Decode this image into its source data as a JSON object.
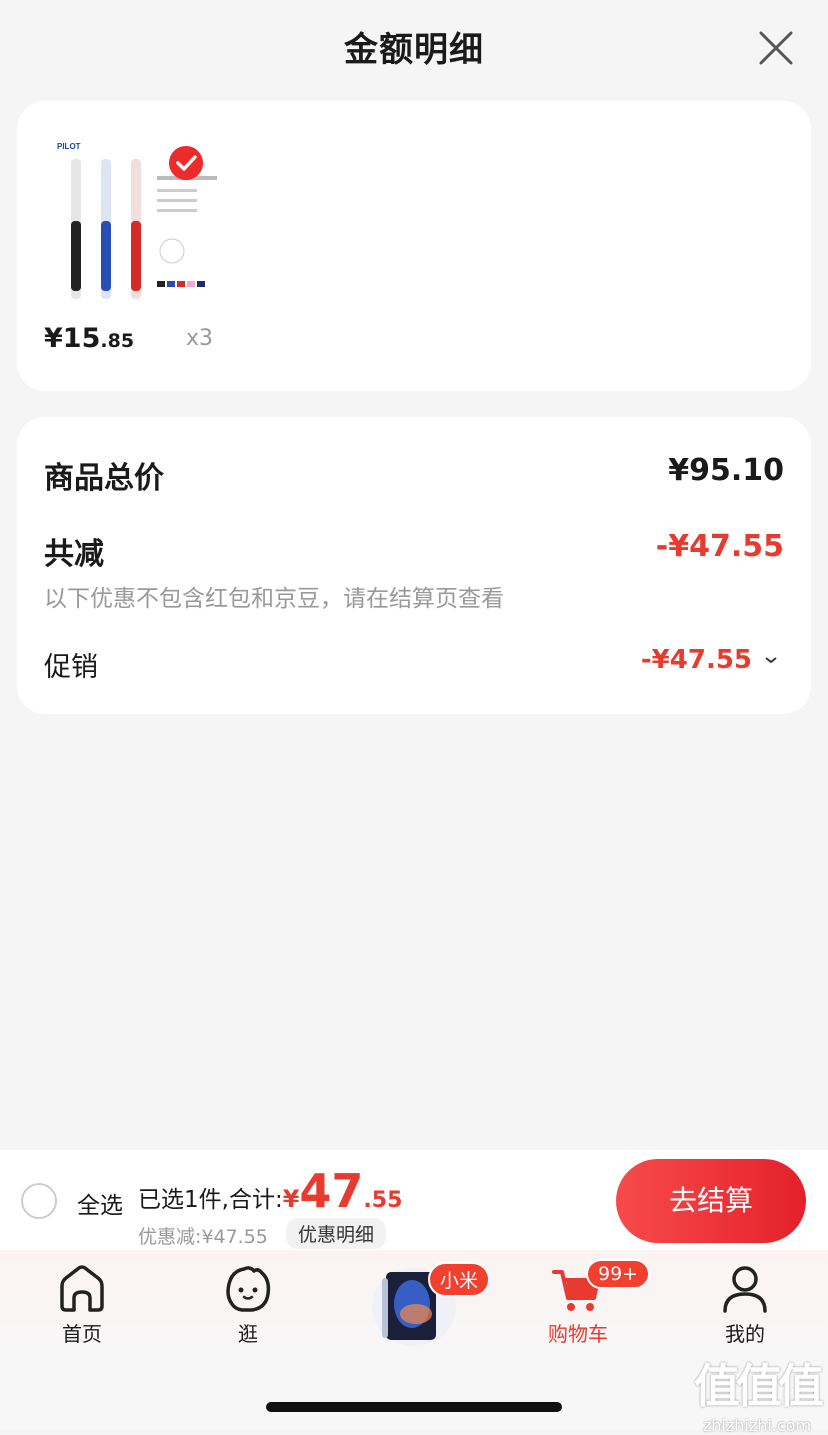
{
  "header": {
    "title": "金额明细"
  },
  "product": {
    "price_int": "¥15",
    "price_dec": ".85",
    "quantity": "x3"
  },
  "summary": {
    "total_label": "商品总价",
    "total_value": "¥95.10",
    "reduce_label": "共减",
    "reduce_value": "-¥47.55",
    "note": "以下优惠不包含红包和京豆，请在结算页查看",
    "promo_label": "促销",
    "promo_value": "-¥47.55"
  },
  "checkout_bar": {
    "select_all": "全选",
    "selected_text": "已选1件,合计:",
    "yen": "¥",
    "total_int": "47",
    "total_dec": ".55",
    "discount_text": "优惠减:¥47.55",
    "detail_button": "优惠明细",
    "checkout_button": "去结算"
  },
  "tabbar": {
    "items": [
      {
        "label": "首页",
        "icon": "home-icon"
      },
      {
        "label": "逛",
        "icon": "browse-icon"
      },
      {
        "label": "小米",
        "icon": "tablet-promo"
      },
      {
        "label": "购物车",
        "icon": "cart-icon",
        "badge": "99+"
      },
      {
        "label": "我的",
        "icon": "user-icon"
      }
    ]
  },
  "watermark": {
    "mark": "值值值",
    "domain": "zhizhizhi.com"
  },
  "colors": {
    "accent": "#e83a2f",
    "background": "#f5f5f5"
  }
}
